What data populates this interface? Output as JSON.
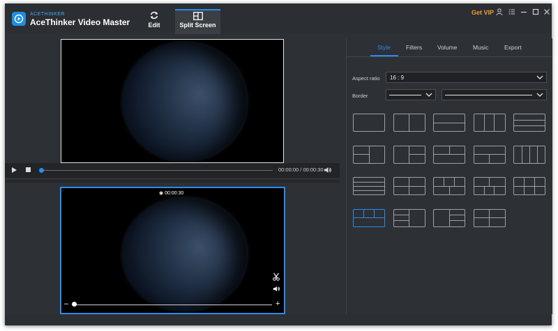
{
  "app": {
    "brand_small": "ACETHINKER",
    "title": "AceThinker Video Master",
    "accent_color": "#2a8cf0",
    "vip_color": "#f39b2c"
  },
  "nav": {
    "edit_label": "Edit",
    "split_label": "Split Screen",
    "get_vip": "Get VIP"
  },
  "window_controls": [
    "user-icon",
    "list-icon",
    "minimize-icon",
    "maximize-icon",
    "close-icon"
  ],
  "player": {
    "time": "00:00:00 / 00:00:30",
    "progress": 0
  },
  "clip": {
    "duration": "00:00:30",
    "zoom": 0
  },
  "right_tabs": [
    "Style",
    "Filters",
    "Volume",
    "Music",
    "Export"
  ],
  "active_tab": "Style",
  "style": {
    "aspect_label": "Aspect ratio",
    "aspect_value": "16 : 9",
    "border_label": "Border"
  },
  "selected_layout": 15
}
